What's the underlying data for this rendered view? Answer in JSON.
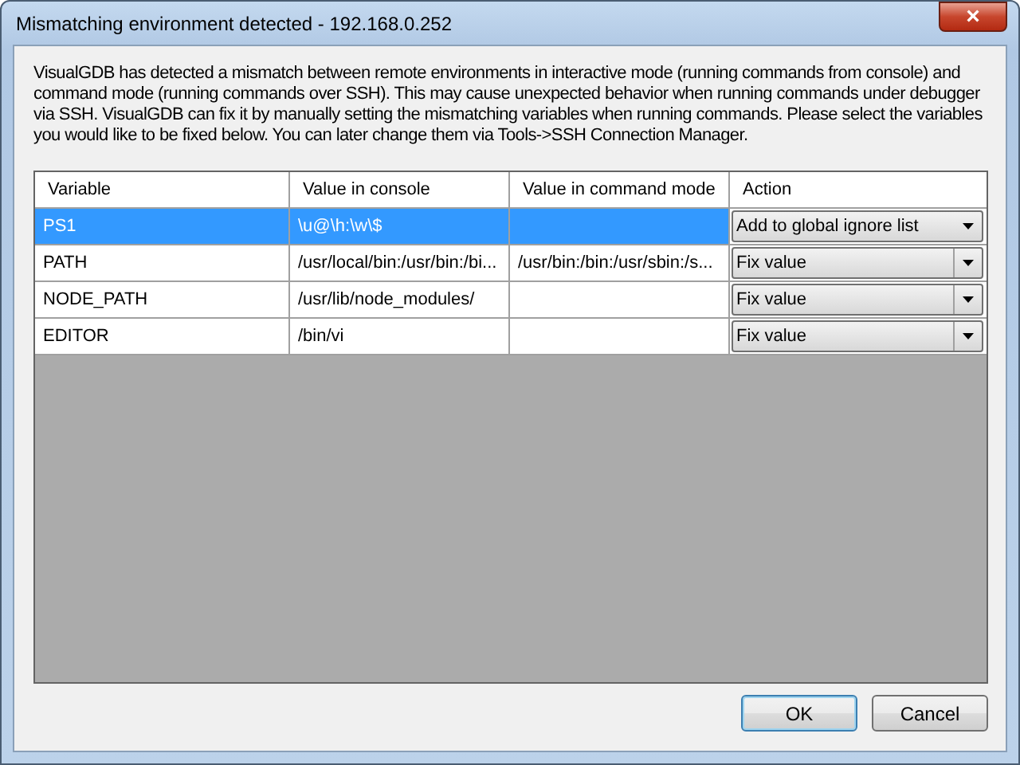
{
  "window": {
    "title": "Mismatching environment detected - 192.168.0.252",
    "close": "×"
  },
  "description": "VisualGDB has detected a mismatch between remote environments in interactive mode (running commands from console) and command mode (running commands over SSH). This may cause unexpected behavior when running commands under debugger via SSH. VisualGDB can fix it by manually setting the mismatching variables when running commands. Please select the variables you would like to be fixed below. You can later change them via Tools->SSH Connection Manager.",
  "table": {
    "columns": [
      "Variable",
      "Value in console",
      "Value in command mode",
      "Action"
    ],
    "rows": [
      {
        "variable": "PS1",
        "console": "\\u@\\h:\\w\\$",
        "command": "",
        "action": "Add to global ignore list",
        "selected": true
      },
      {
        "variable": "PATH",
        "console": "/usr/local/bin:/usr/bin:/bi...",
        "command": "/usr/bin:/bin:/usr/sbin:/s...",
        "action": "Fix value",
        "selected": false
      },
      {
        "variable": "NODE_PATH",
        "console": "/usr/lib/node_modules/",
        "command": "",
        "action": "Fix value",
        "selected": false
      },
      {
        "variable": "EDITOR",
        "console": "/bin/vi",
        "command": "",
        "action": "Fix value",
        "selected": false
      }
    ]
  },
  "buttons": [
    {
      "label": "OK",
      "default": true
    },
    {
      "label": "Cancel",
      "default": false
    }
  ]
}
